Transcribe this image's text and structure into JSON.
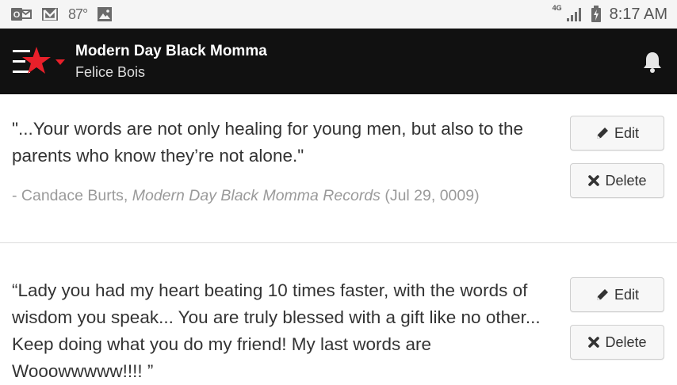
{
  "status_bar": {
    "temperature": "87°",
    "network": "4G",
    "time": "8:17 AM"
  },
  "header": {
    "title": "Modern Day Black Momma",
    "subtitle": "Felice Bois",
    "brand_colors": {
      "star": "#e8202a",
      "bar": "#111111"
    }
  },
  "testimonials": [
    {
      "quote": "\"...Your words are not only healing for young men, but also to the parents who know they’re not alone.\"",
      "author_prefix": "- Candace Burts, ",
      "source": "Modern Day Black Momma Records",
      "date": " (Jul 29, 0009)",
      "edit_label": "Edit",
      "delete_label": "Delete"
    },
    {
      "quote": "“Lady you had my heart beating 10 times faster, with the words of wisdom you speak... You are truly blessed with a gift like no other... Keep doing what you do my friend! My last words are Wooowwwww!!!! ”",
      "edit_label": "Edit",
      "delete_label": "Delete"
    }
  ],
  "icons": {
    "status_left": [
      "outlook-icon",
      "gmail-icon",
      "weather-icon",
      "gallery-icon"
    ],
    "status_right": [
      "signal-icon",
      "battery-charging-icon"
    ],
    "header": [
      "menu-star-logo-icon",
      "dropdown-caret-icon",
      "notification-bell-icon"
    ],
    "buttons": [
      "pencil-icon",
      "close-x-icon"
    ]
  }
}
